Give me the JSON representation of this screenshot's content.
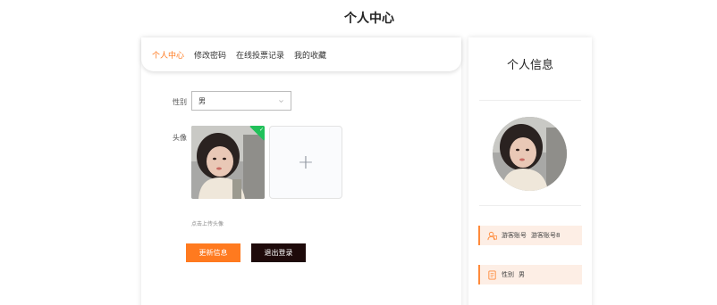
{
  "page": {
    "title": "个人中心"
  },
  "tabs": [
    {
      "label": "个人中心",
      "active": true
    },
    {
      "label": "修改密码",
      "active": false
    },
    {
      "label": "在线投票记录",
      "active": false
    },
    {
      "label": "我的收藏",
      "active": false
    }
  ],
  "form": {
    "gender_label": "性别",
    "gender_value": "男",
    "avatar_label": "头像",
    "upload_hint": "点击上传头像",
    "update_button": "更新信息",
    "logout_button": "退出登录"
  },
  "sidebar": {
    "title": "个人信息",
    "account_label": "游客账号",
    "account_value": "游客账号8",
    "gender_label": "性别",
    "gender_value": "男"
  },
  "colors": {
    "accent": "#ff7a1f",
    "dark_button": "#1e0a0a",
    "info_bg": "#fdeee5",
    "success": "#21c15a"
  },
  "icons": [
    "chevron-down-icon",
    "plus-icon",
    "check-icon",
    "user-id-icon",
    "document-icon"
  ]
}
